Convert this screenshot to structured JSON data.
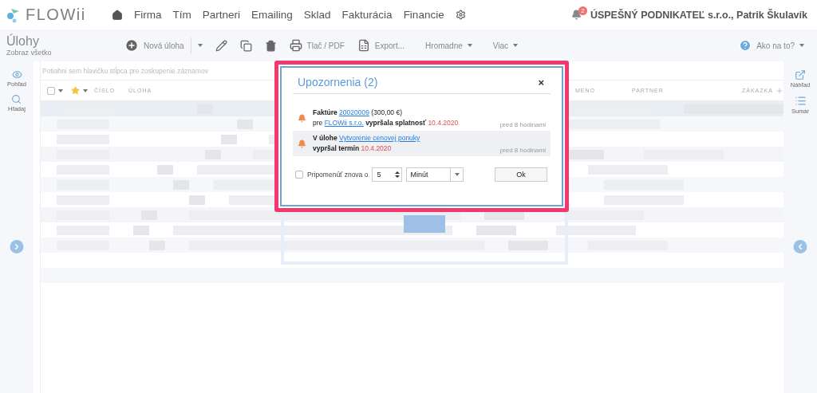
{
  "nav": {
    "logo": "FLOWii",
    "items": [
      "Firma",
      "Tím",
      "Partneri",
      "Emailing",
      "Sklad",
      "Fakturácia",
      "Financie"
    ],
    "notification_count": "2",
    "user": "ÚSPEŠNÝ PODNIKATEĽ s.r.o., Patrik Škulavík"
  },
  "toolbar": {
    "title": "Úlohy",
    "subtitle": "Zobraz všetko",
    "new_label": "Nová úloha",
    "print_label": "Tlač / PDF",
    "export_label": "Export...",
    "bulk_label": "Hromadne",
    "more_label": "Viac",
    "help_label": "Ako na to?"
  },
  "left_panel": {
    "items": [
      "Pohľad",
      "Hľadaj"
    ]
  },
  "right_panel": {
    "items": [
      "Náhľad",
      "Sumár"
    ]
  },
  "grid": {
    "group_hint": "Potiahni sem hlavičku stĺpca pre zoskupenie záznamov",
    "select_all_checked": false,
    "columns": [
      "ČÍSLO",
      "ÚLOHA",
      "MENO",
      "PARTNER",
      "ZÁKAZKA"
    ]
  },
  "dialog": {
    "title": "Upozornenia (2)",
    "close": "×",
    "notifications": [
      {
        "highlighted": false,
        "time": "pred 8 hodinami",
        "lines": [
          [
            {
              "kind": "bold",
              "text": "Faktúre "
            },
            {
              "kind": "link",
              "text": "20020009"
            },
            {
              "kind": "plain",
              "text": " (300,00 €)"
            }
          ],
          [
            {
              "kind": "plain",
              "text": "pre "
            },
            {
              "kind": "link",
              "text": "FLOWii s.r.o."
            },
            {
              "kind": "bold",
              "text": " vypršala splatnosť "
            },
            {
              "kind": "date",
              "text": "10.4.2020"
            }
          ]
        ]
      },
      {
        "highlighted": true,
        "time": "pred 8 hodinami",
        "lines": [
          [
            {
              "kind": "bold",
              "text": "V úlohe "
            },
            {
              "kind": "link",
              "text": "Vytvorenie cenovej ponuky"
            }
          ],
          [
            {
              "kind": "bold",
              "text": "vypršal termín "
            },
            {
              "kind": "date",
              "text": "10.4.2020"
            }
          ]
        ]
      }
    ],
    "remind": {
      "checked": false,
      "label": "Pripomenúť znova o",
      "amount": "5",
      "unit": "Minút"
    },
    "ok": "Ok"
  }
}
